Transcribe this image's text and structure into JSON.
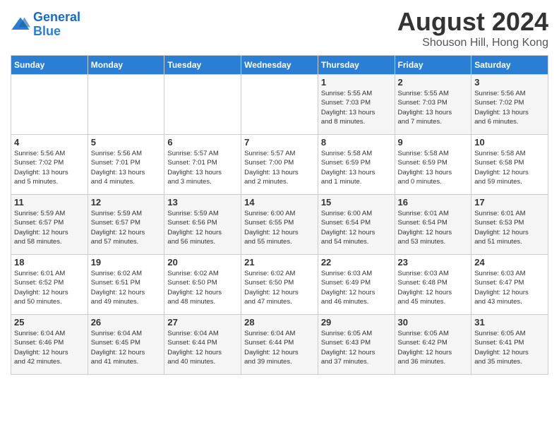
{
  "logo": {
    "line1": "General",
    "line2": "Blue"
  },
  "title": "August 2024",
  "subtitle": "Shouson Hill, Hong Kong",
  "headers": [
    "Sunday",
    "Monday",
    "Tuesday",
    "Wednesday",
    "Thursday",
    "Friday",
    "Saturday"
  ],
  "rows": [
    [
      {
        "day": "",
        "info": ""
      },
      {
        "day": "",
        "info": ""
      },
      {
        "day": "",
        "info": ""
      },
      {
        "day": "",
        "info": ""
      },
      {
        "day": "1",
        "info": "Sunrise: 5:55 AM\nSunset: 7:03 PM\nDaylight: 13 hours\nand 8 minutes."
      },
      {
        "day": "2",
        "info": "Sunrise: 5:55 AM\nSunset: 7:03 PM\nDaylight: 13 hours\nand 7 minutes."
      },
      {
        "day": "3",
        "info": "Sunrise: 5:56 AM\nSunset: 7:02 PM\nDaylight: 13 hours\nand 6 minutes."
      }
    ],
    [
      {
        "day": "4",
        "info": "Sunrise: 5:56 AM\nSunset: 7:02 PM\nDaylight: 13 hours\nand 5 minutes."
      },
      {
        "day": "5",
        "info": "Sunrise: 5:56 AM\nSunset: 7:01 PM\nDaylight: 13 hours\nand 4 minutes."
      },
      {
        "day": "6",
        "info": "Sunrise: 5:57 AM\nSunset: 7:01 PM\nDaylight: 13 hours\nand 3 minutes."
      },
      {
        "day": "7",
        "info": "Sunrise: 5:57 AM\nSunset: 7:00 PM\nDaylight: 13 hours\nand 2 minutes."
      },
      {
        "day": "8",
        "info": "Sunrise: 5:58 AM\nSunset: 6:59 PM\nDaylight: 13 hours\nand 1 minute."
      },
      {
        "day": "9",
        "info": "Sunrise: 5:58 AM\nSunset: 6:59 PM\nDaylight: 13 hours\nand 0 minutes."
      },
      {
        "day": "10",
        "info": "Sunrise: 5:58 AM\nSunset: 6:58 PM\nDaylight: 12 hours\nand 59 minutes."
      }
    ],
    [
      {
        "day": "11",
        "info": "Sunrise: 5:59 AM\nSunset: 6:57 PM\nDaylight: 12 hours\nand 58 minutes."
      },
      {
        "day": "12",
        "info": "Sunrise: 5:59 AM\nSunset: 6:57 PM\nDaylight: 12 hours\nand 57 minutes."
      },
      {
        "day": "13",
        "info": "Sunrise: 5:59 AM\nSunset: 6:56 PM\nDaylight: 12 hours\nand 56 minutes."
      },
      {
        "day": "14",
        "info": "Sunrise: 6:00 AM\nSunset: 6:55 PM\nDaylight: 12 hours\nand 55 minutes."
      },
      {
        "day": "15",
        "info": "Sunrise: 6:00 AM\nSunset: 6:54 PM\nDaylight: 12 hours\nand 54 minutes."
      },
      {
        "day": "16",
        "info": "Sunrise: 6:01 AM\nSunset: 6:54 PM\nDaylight: 12 hours\nand 53 minutes."
      },
      {
        "day": "17",
        "info": "Sunrise: 6:01 AM\nSunset: 6:53 PM\nDaylight: 12 hours\nand 51 minutes."
      }
    ],
    [
      {
        "day": "18",
        "info": "Sunrise: 6:01 AM\nSunset: 6:52 PM\nDaylight: 12 hours\nand 50 minutes."
      },
      {
        "day": "19",
        "info": "Sunrise: 6:02 AM\nSunset: 6:51 PM\nDaylight: 12 hours\nand 49 minutes."
      },
      {
        "day": "20",
        "info": "Sunrise: 6:02 AM\nSunset: 6:50 PM\nDaylight: 12 hours\nand 48 minutes."
      },
      {
        "day": "21",
        "info": "Sunrise: 6:02 AM\nSunset: 6:50 PM\nDaylight: 12 hours\nand 47 minutes."
      },
      {
        "day": "22",
        "info": "Sunrise: 6:03 AM\nSunset: 6:49 PM\nDaylight: 12 hours\nand 46 minutes."
      },
      {
        "day": "23",
        "info": "Sunrise: 6:03 AM\nSunset: 6:48 PM\nDaylight: 12 hours\nand 45 minutes."
      },
      {
        "day": "24",
        "info": "Sunrise: 6:03 AM\nSunset: 6:47 PM\nDaylight: 12 hours\nand 43 minutes."
      }
    ],
    [
      {
        "day": "25",
        "info": "Sunrise: 6:04 AM\nSunset: 6:46 PM\nDaylight: 12 hours\nand 42 minutes."
      },
      {
        "day": "26",
        "info": "Sunrise: 6:04 AM\nSunset: 6:45 PM\nDaylight: 12 hours\nand 41 minutes."
      },
      {
        "day": "27",
        "info": "Sunrise: 6:04 AM\nSunset: 6:44 PM\nDaylight: 12 hours\nand 40 minutes."
      },
      {
        "day": "28",
        "info": "Sunrise: 6:04 AM\nSunset: 6:44 PM\nDaylight: 12 hours\nand 39 minutes."
      },
      {
        "day": "29",
        "info": "Sunrise: 6:05 AM\nSunset: 6:43 PM\nDaylight: 12 hours\nand 37 minutes."
      },
      {
        "day": "30",
        "info": "Sunrise: 6:05 AM\nSunset: 6:42 PM\nDaylight: 12 hours\nand 36 minutes."
      },
      {
        "day": "31",
        "info": "Sunrise: 6:05 AM\nSunset: 6:41 PM\nDaylight: 12 hours\nand 35 minutes."
      }
    ]
  ]
}
